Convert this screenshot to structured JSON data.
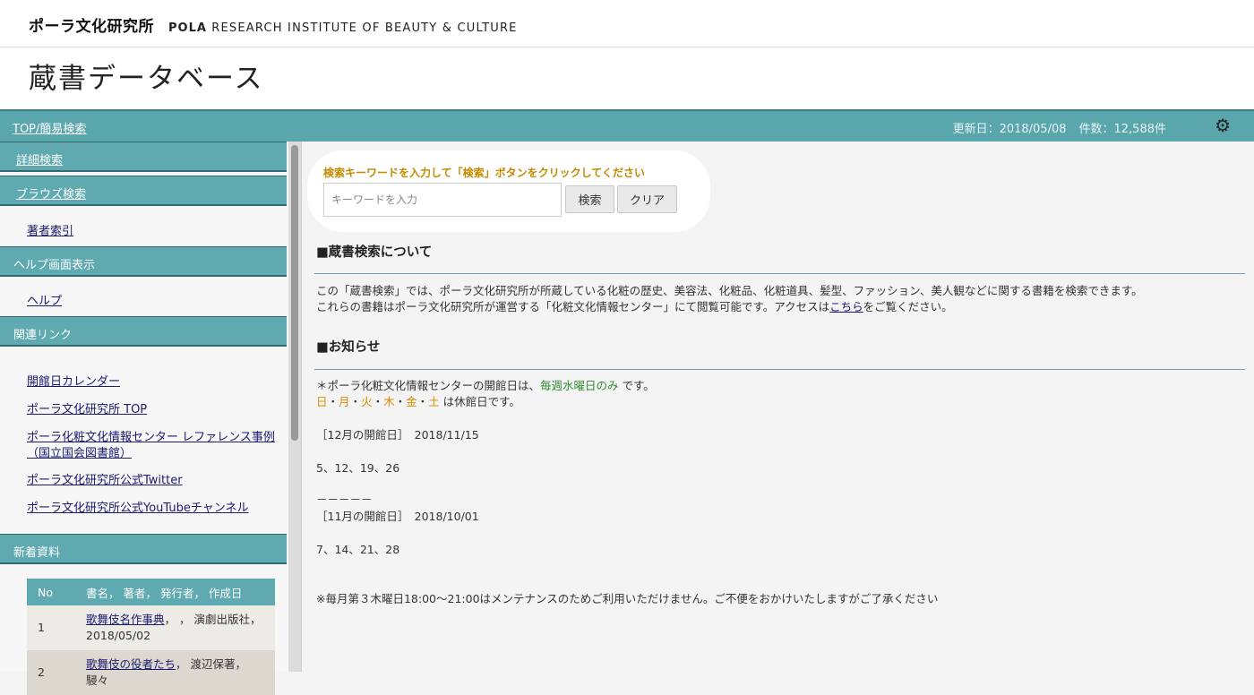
{
  "header": {
    "brand_jp": "ポーラ文化研究所",
    "brand_en_bold": "POLA",
    "brand_en_rest": "RESEARCH INSTITUTE OF BEAUTY & CULTURE",
    "title": "蔵書データベース"
  },
  "navbar": {
    "top_link": "TOP/簡易検索",
    "updated": "更新日：2018/05/08",
    "count": "件数：12,588件",
    "gear_icon": "gear-icon"
  },
  "sidebar": {
    "sections": [
      {
        "label": "詳細検索"
      },
      {
        "label": "ブラウズ検索"
      }
    ],
    "author_index": "著者索引",
    "help_head": "ヘルプ画面表示",
    "help_link": "ヘルプ",
    "links_head": "関連リンク",
    "links": [
      "開館日カレンダー",
      "ポーラ文化研究所 TOP",
      "ポーラ化粧文化情報センター レファレンス事例",
      "（国立国会図書館）",
      "ポーラ文化研究所公式Twitter",
      "ポーラ文化研究所公式YouTubeチャンネル"
    ],
    "new_head": "新着資料",
    "table": {
      "headers": [
        "No",
        "書名， 著者， 発行者， 作成日"
      ],
      "rows": [
        {
          "no": "1",
          "title": "歌舞伎名作事典",
          "rest": "， ， 演劇出版社，",
          "date": "2018/05/02"
        },
        {
          "no": "2",
          "title": "歌舞伎の役者たち",
          "rest": "， 渡辺保著， 駸々",
          "date": ""
        }
      ]
    }
  },
  "search": {
    "label": "検索キーワードを入力して「検索」ボタンをクリックしてください",
    "placeholder": "キーワードを入力",
    "search_button": "検索",
    "clear_button": "クリア"
  },
  "about": {
    "title": "■蔵書検索について",
    "line1": "この「蔵書検索」では、ポーラ文化研究所が所蔵している化粧の歴史、美容法、化粧品、化粧道具、髪型、ファッション、美人観などに関する書籍を検索できます。",
    "line2_pre": "これらの書籍はポーラ文化研究所が運営する「化粧文化情報センター」にて閲覧可能です。アクセスは",
    "line2_link": "こちら",
    "line2_post": "をご覧ください。"
  },
  "news": {
    "title": "■お知らせ",
    "open_pre": "＊ポーラ化粧文化情報センターの開館日は、",
    "open_green": "毎週水曜日のみ",
    "open_post": " です。",
    "closed_days": [
      "日",
      "月",
      "火",
      "木",
      "金",
      "土"
    ],
    "closed_sep": "・",
    "closed_post": " は休館日です。",
    "dec_label": "［12月の開館日］　2018/11/15",
    "dec_days": "5、12、19、26",
    "divider": "－－－－－",
    "nov_label": "［11月の開館日］　2018/10/01",
    "nov_days": "7、14、21、28",
    "maintenance": "※毎月第３木曜日18:00〜21:00はメンテナンスのためご利用いただけません。ご不便をおかけいたしますがご了承ください"
  }
}
